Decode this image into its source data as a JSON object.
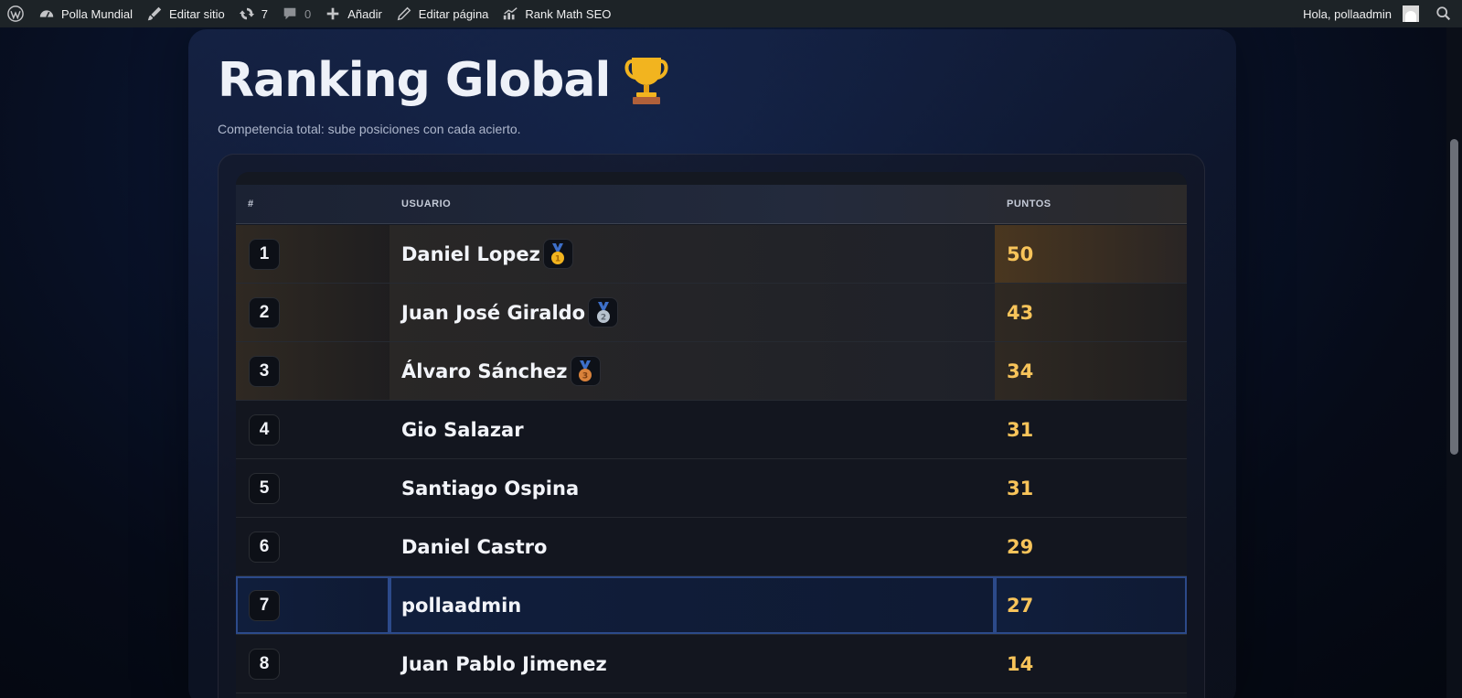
{
  "adminbar": {
    "site_name": "Polla Mundial",
    "edit_site": "Editar sitio",
    "updates_count": "7",
    "comments_count": "0",
    "add_new": "Añadir",
    "edit_page": "Editar página",
    "rank_math": "Rank Math SEO",
    "greeting": "Hola, pollaadmin"
  },
  "page": {
    "title": "Ranking Global",
    "title_emoji": "trophy-icon",
    "subtitle": "Competencia total: sube posiciones con cada acierto."
  },
  "table": {
    "headers": {
      "rank": "#",
      "user": "USUARIO",
      "points": "PUNTOS"
    },
    "rows": [
      {
        "rank": "1",
        "user": "Daniel Lopez",
        "points": "50",
        "medal": "gold-medal-icon"
      },
      {
        "rank": "2",
        "user": "Juan José Giraldo",
        "points": "43",
        "medal": "silver-medal-icon"
      },
      {
        "rank": "3",
        "user": "Álvaro Sánchez",
        "points": "34",
        "medal": "bronze-medal-icon"
      },
      {
        "rank": "4",
        "user": "Gio Salazar",
        "points": "31"
      },
      {
        "rank": "5",
        "user": "Santiago Ospina",
        "points": "31"
      },
      {
        "rank": "6",
        "user": "Daniel Castro",
        "points": "29"
      },
      {
        "rank": "7",
        "user": "pollaadmin",
        "points": "27",
        "current_user": true
      },
      {
        "rank": "8",
        "user": "Juan Pablo Jimenez",
        "points": "14"
      }
    ]
  },
  "colors": {
    "points": "#f8c45a",
    "current_user_border": "#2c4a8a",
    "adminbar_bg": "#1d2327",
    "gold": "#f2b41f",
    "silver": "#b8c3cf",
    "bronze": "#d9823b",
    "ribbon": "#3d6fc9"
  }
}
